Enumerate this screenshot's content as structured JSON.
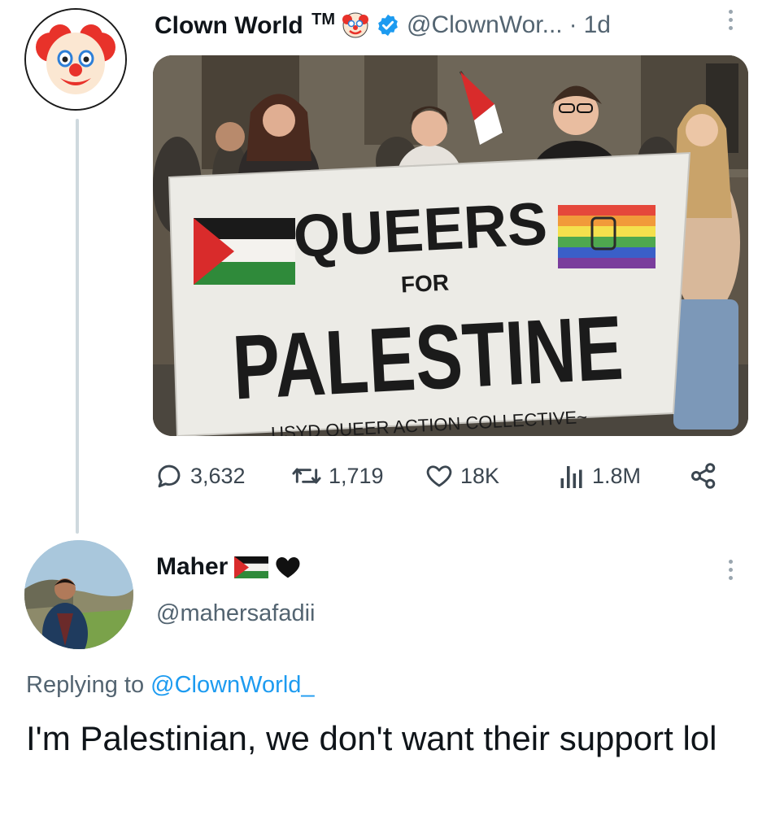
{
  "tweet": {
    "author_name": "Clown World",
    "trademark": "TM",
    "handle": "@ClownWor...",
    "separator": "·",
    "time": "1d",
    "photo_text": {
      "line1": "QUEERS",
      "line2": "FOR",
      "line3": "PALESTINE",
      "footer": "USYD QUEER ACTION COLLECTIVE~"
    },
    "stats": {
      "replies": "3,632",
      "retweets": "1,719",
      "likes": "18K",
      "views": "1.8M"
    }
  },
  "reply": {
    "author_name": "Maher",
    "handle": "@mahersafadii",
    "replying_prefix": "Replying to",
    "replying_to": "@ClownWorld_",
    "text": "I'm Palestinian, we don't want their support lol"
  },
  "colors": {
    "link": "#1d9bf0",
    "muted": "#536471",
    "verified": "#1d9bf0"
  }
}
